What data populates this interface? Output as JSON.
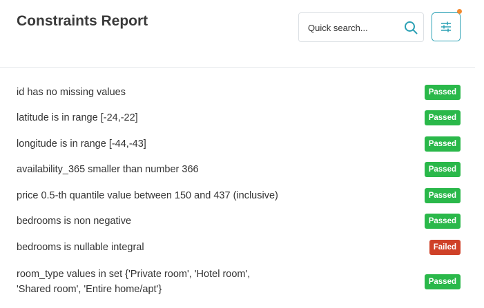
{
  "header": {
    "title": "Constraints Report",
    "search": {
      "placeholder": "Quick search...",
      "icon": "search-icon"
    },
    "filter": {
      "icon": "sliders-icon",
      "indicator_color": "#f28a30"
    }
  },
  "colors": {
    "accent": "#2aa0b4",
    "passed": "#2ab84a",
    "failed": "#cf4128"
  },
  "constraints": [
    {
      "text": "id has no missing values",
      "status": "Passed"
    },
    {
      "text": "latitude is in range [-24,-22]",
      "status": "Passed"
    },
    {
      "text": "longitude is in range [-44,-43]",
      "status": "Passed"
    },
    {
      "text": "availability_365 smaller than number 366",
      "status": "Passed"
    },
    {
      "text": "price 0.5-th quantile value between 150 and 437 (inclusive)",
      "status": "Passed"
    },
    {
      "text": "bedrooms is non negative",
      "status": "Passed"
    },
    {
      "text": "bedrooms is nullable integral",
      "status": "Failed"
    },
    {
      "text": "room_type values in set {'Private room', 'Hotel room', 'Shared room', 'Entire home/apt'}",
      "lines": [
        "room_type values in set {'Private room', 'Hotel room',",
        "'Shared room', 'Entire home/apt'}"
      ],
      "status": "Passed"
    }
  ]
}
